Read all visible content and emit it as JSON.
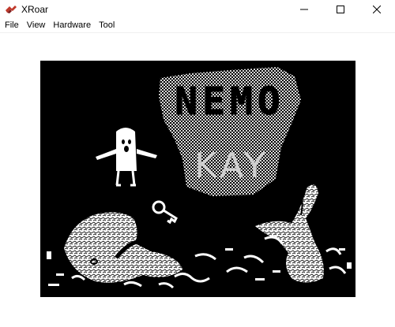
{
  "window": {
    "title": "XRoar",
    "icon": "xroar-app-icon",
    "controls": [
      "minimize-icon",
      "maximize-icon",
      "close-icon"
    ]
  },
  "menu": {
    "items": [
      {
        "label": "File"
      },
      {
        "label": "View"
      },
      {
        "label": "Hardware"
      },
      {
        "label": "Tool"
      }
    ]
  },
  "screen": {
    "title_line1": "NEMO",
    "title_line2": "KAY",
    "colors": {
      "background": "#000000",
      "foreground": "#ffffff",
      "dither": "#9a9a9a"
    }
  }
}
